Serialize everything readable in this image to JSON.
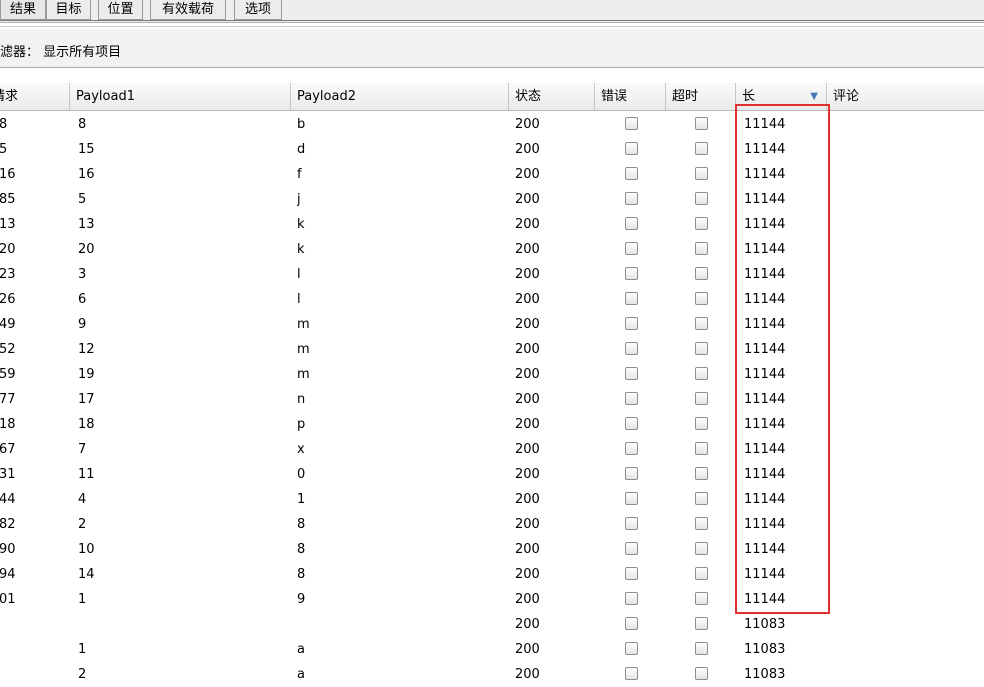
{
  "tabs": [
    "结果",
    "目标",
    "位置",
    "有效载荷",
    "选项"
  ],
  "filter": {
    "label": "过滤器：",
    "value": "显示所有项目"
  },
  "columns": [
    "请求",
    "Payload1",
    "Payload2",
    "状态",
    "错误",
    "超时",
    "长",
    "评论"
  ],
  "sort_column": "长",
  "rows": [
    {
      "req": "8",
      "p1": "8",
      "p2": "b",
      "status": "200",
      "len": "11144"
    },
    {
      "req": "5",
      "p1": "15",
      "p2": "d",
      "status": "200",
      "len": "11144"
    },
    {
      "req": "16",
      "p1": "16",
      "p2": "f",
      "status": "200",
      "len": "11144"
    },
    {
      "req": "85",
      "p1": "5",
      "p2": "j",
      "status": "200",
      "len": "11144"
    },
    {
      "req": "13",
      "p1": "13",
      "p2": "k",
      "status": "200",
      "len": "11144"
    },
    {
      "req": "20",
      "p1": "20",
      "p2": "k",
      "status": "200",
      "len": "11144"
    },
    {
      "req": "23",
      "p1": "3",
      "p2": "l",
      "status": "200",
      "len": "11144"
    },
    {
      "req": "26",
      "p1": "6",
      "p2": "l",
      "status": "200",
      "len": "11144"
    },
    {
      "req": "49",
      "p1": "9",
      "p2": "m",
      "status": "200",
      "len": "11144"
    },
    {
      "req": "52",
      "p1": "12",
      "p2": "m",
      "status": "200",
      "len": "11144"
    },
    {
      "req": "59",
      "p1": "19",
      "p2": "m",
      "status": "200",
      "len": "11144"
    },
    {
      "req": "77",
      "p1": "17",
      "p2": "n",
      "status": "200",
      "len": "11144"
    },
    {
      "req": "18",
      "p1": "18",
      "p2": "p",
      "status": "200",
      "len": "11144"
    },
    {
      "req": "67",
      "p1": "7",
      "p2": "x",
      "status": "200",
      "len": "11144"
    },
    {
      "req": "31",
      "p1": "11",
      "p2": "0",
      "status": "200",
      "len": "11144"
    },
    {
      "req": "44",
      "p1": "4",
      "p2": "1",
      "status": "200",
      "len": "11144"
    },
    {
      "req": "82",
      "p1": "2",
      "p2": "8",
      "status": "200",
      "len": "11144"
    },
    {
      "req": "90",
      "p1": "10",
      "p2": "8",
      "status": "200",
      "len": "11144"
    },
    {
      "req": "94",
      "p1": "14",
      "p2": "8",
      "status": "200",
      "len": "11144"
    },
    {
      "req": "01",
      "p1": "1",
      "p2": "9",
      "status": "200",
      "len": "11144"
    },
    {
      "req": "",
      "p1": "",
      "p2": "",
      "status": "200",
      "len": "11083"
    },
    {
      "req": "",
      "p1": "1",
      "p2": "a",
      "status": "200",
      "len": "11083"
    },
    {
      "req": "",
      "p1": "2",
      "p2": "a",
      "status": "200",
      "len": "11083"
    }
  ],
  "colors": {
    "highlight": "#e03030",
    "sort_arrow": "#4a78b8"
  }
}
